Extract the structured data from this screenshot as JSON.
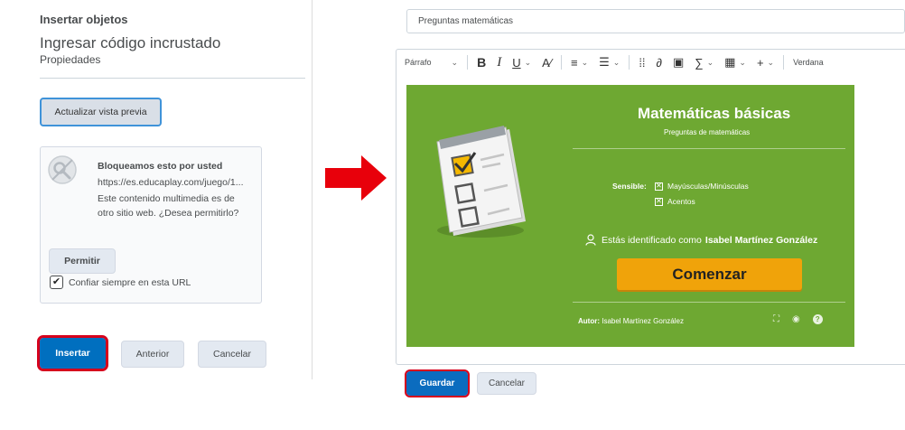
{
  "dialog": {
    "title": "Insertar objetos",
    "heading": "Ingresar código incrustado",
    "subheading": "Propiedades",
    "preview_button": "Actualizar vista previa",
    "blocked": {
      "title": "Bloqueamos esto por usted",
      "url": "https://es.educaplay.com/juego/1...",
      "message": "Este contenido multimedia es de otro sitio web. ¿Desea permitirlo?",
      "allow_button": "Permitir",
      "trust_checkbox": {
        "label": "Confiar siempre en esta URL",
        "checked": true
      }
    },
    "insert_button": "Insertar",
    "previous_button": "Anterior",
    "cancel_button": "Cancelar"
  },
  "editor": {
    "title_value": "Preguntas matemáticas",
    "toolbar": {
      "paragraph": "Párrafo",
      "bold": "B",
      "italic": "I",
      "underline": "U",
      "font": "Verdana",
      "sigma": "∑",
      "plus": "+"
    },
    "quiz": {
      "title": "Matemáticas básicas",
      "subtitle": "Preguntas de matemáticas",
      "sensitive_label": "Sensible:",
      "option1": "Mayúsculas/Minúsculas",
      "option2": "Acentos",
      "identified_prefix": "Estás identificado como",
      "user_name": "Isabel Martínez González",
      "start_button": "Comenzar",
      "author_label": "Autor:",
      "author_name": "Isabel Martínez González"
    },
    "save_button": "Guardar",
    "cancel_button": "Cancelar"
  },
  "colors": {
    "primary": "#006fbf",
    "highlight": "#d6001c",
    "quiz_bg": "#6ea832",
    "start_button": "#f0a30a",
    "arrow": "#e8000b"
  }
}
